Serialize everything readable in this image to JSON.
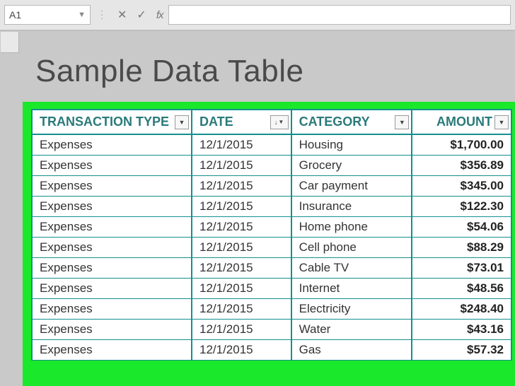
{
  "formula_bar": {
    "cell_ref": "A1",
    "cancel": "✕",
    "confirm": "✓",
    "fx": "fx",
    "value": ""
  },
  "title": "Sample Data Table",
  "columns": {
    "type": "TRANSACTION TYPE",
    "date": "DATE",
    "category": "CATEGORY",
    "amount": "AMOUNT"
  },
  "rows": [
    {
      "type": "Expenses",
      "date": "12/1/2015",
      "category": "Housing",
      "amount": "$1,700.00"
    },
    {
      "type": "Expenses",
      "date": "12/1/2015",
      "category": "Grocery",
      "amount": "$356.89"
    },
    {
      "type": "Expenses",
      "date": "12/1/2015",
      "category": "Car payment",
      "amount": "$345.00"
    },
    {
      "type": "Expenses",
      "date": "12/1/2015",
      "category": "Insurance",
      "amount": "$122.30"
    },
    {
      "type": "Expenses",
      "date": "12/1/2015",
      "category": "Home phone",
      "amount": "$54.06"
    },
    {
      "type": "Expenses",
      "date": "12/1/2015",
      "category": "Cell phone",
      "amount": "$88.29"
    },
    {
      "type": "Expenses",
      "date": "12/1/2015",
      "category": "Cable TV",
      "amount": "$73.01"
    },
    {
      "type": "Expenses",
      "date": "12/1/2015",
      "category": "Internet",
      "amount": "$48.56"
    },
    {
      "type": "Expenses",
      "date": "12/1/2015",
      "category": "Electricity",
      "amount": "$248.40"
    },
    {
      "type": "Expenses",
      "date": "12/1/2015",
      "category": "Water",
      "amount": "$43.16"
    },
    {
      "type": "Expenses",
      "date": "12/1/2015",
      "category": "Gas",
      "amount": "$57.32"
    }
  ]
}
